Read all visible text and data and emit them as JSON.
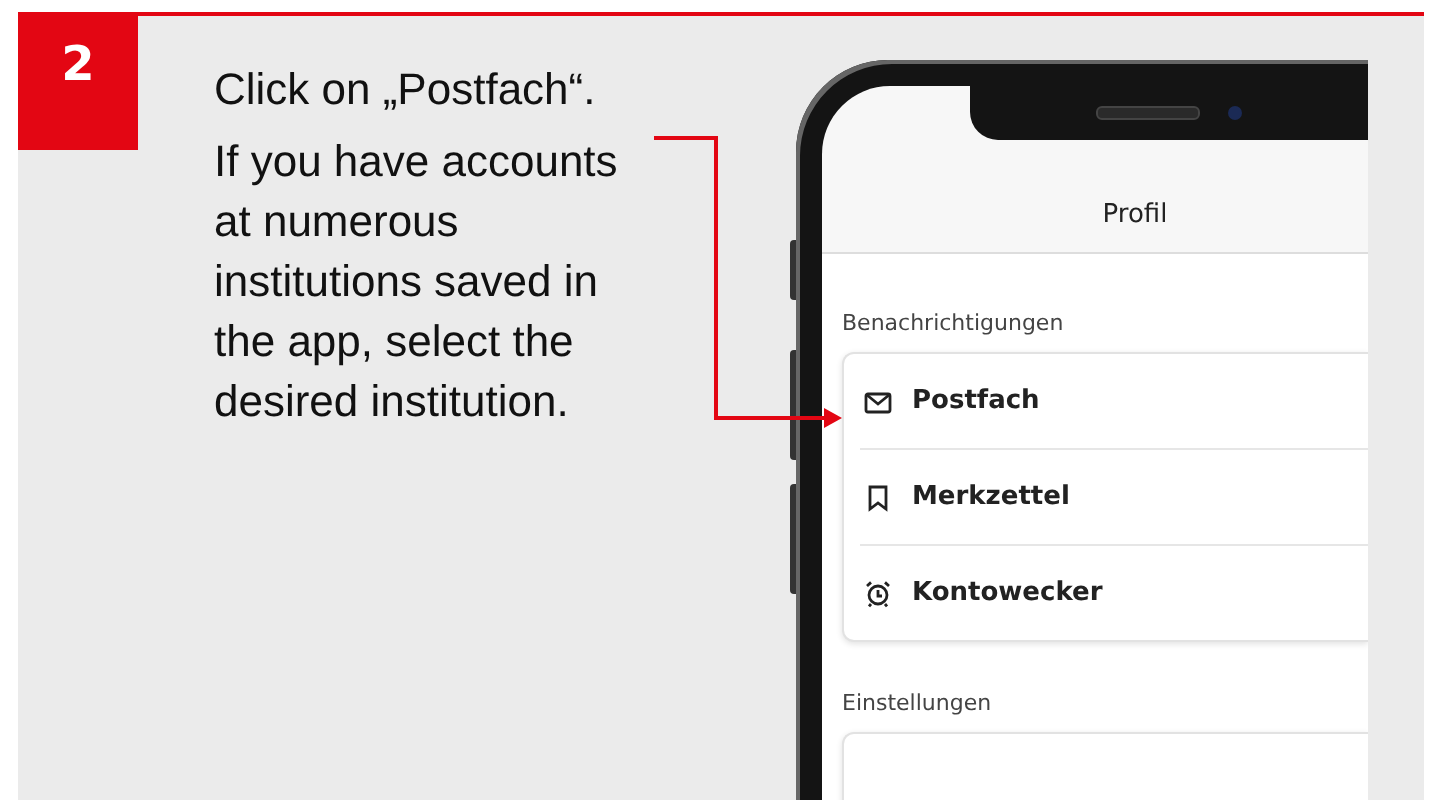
{
  "step": {
    "number": "2",
    "title": "Click on „Postfach“.",
    "text": "If you have accounts at numerous institutions saved in the app, select the desired institution."
  },
  "phone": {
    "header": {
      "title": "Profil"
    },
    "sections": [
      {
        "heading": "Benachrichtigungen",
        "items": [
          {
            "label": "Postfach",
            "kind": "mail"
          },
          {
            "label": "Merkzettel",
            "kind": "bookmark"
          },
          {
            "label": "Kontowecker",
            "kind": "alarm"
          }
        ]
      },
      {
        "heading": "Einstellungen"
      }
    ]
  }
}
